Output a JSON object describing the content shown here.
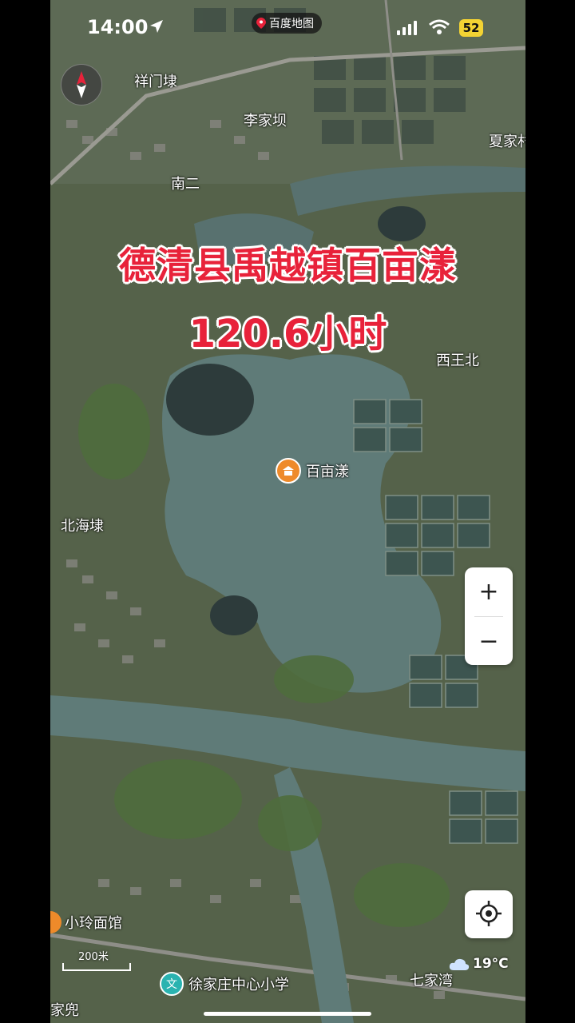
{
  "status_bar": {
    "time": "14:00",
    "app_badge": "百度地图",
    "battery": "52"
  },
  "map": {
    "view": "satellite",
    "places": [
      {
        "key": "xiangmenlu",
        "label": "祥门埭"
      },
      {
        "key": "lijiaba",
        "label": "李家坝"
      },
      {
        "key": "xiajia",
        "label": "夏家村"
      },
      {
        "key": "naner",
        "label": "南二"
      },
      {
        "key": "xiwangbei",
        "label": "西王北"
      },
      {
        "key": "beihailu",
        "label": "北海埭"
      },
      {
        "key": "qijiawan",
        "label": "七家湾"
      },
      {
        "key": "jiadou",
        "label": "家兜"
      }
    ],
    "poi_lake": {
      "label": "百亩漾",
      "icon": "scenic-spot-icon"
    },
    "poi_restaurant": {
      "label": "小玲面馆",
      "icon": "restaurant-icon"
    },
    "poi_school": {
      "label": "徐家庄中心小学",
      "icon_text": "文"
    },
    "scale_label": "200米",
    "weather": {
      "temp": "19°C",
      "icon": "cloud-icon"
    }
  },
  "overlay": {
    "line1": "德清县禹越镇百亩漾",
    "line2": "120.6小时"
  },
  "controls": {
    "zoom_in": "+",
    "zoom_out": "−"
  }
}
